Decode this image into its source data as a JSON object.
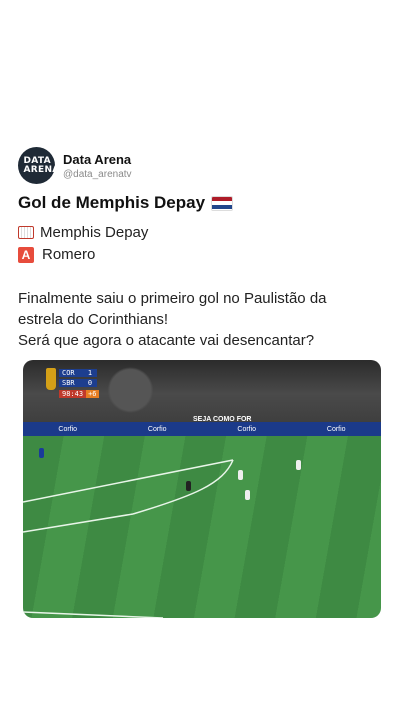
{
  "account": {
    "avatar_text": "DATA ARENA",
    "name": "Data Arena",
    "handle": "@data_arenatv"
  },
  "post": {
    "title": "Gol de Memphis Depay",
    "goal_line": "Memphis Depay",
    "assist_line": "Romero",
    "assist_badge": "A",
    "body_lines": [
      "Finalmente saiu o primeiro gol no Paulistão da",
      "estrela do Corinthians!",
      "Será que agora o atacante vai desencantar?"
    ]
  },
  "video": {
    "scorebug": {
      "team1": "COR",
      "score1": "1",
      "team2": "SBR",
      "score2": "0",
      "time": "98:43",
      "added": "+6"
    },
    "banner_texts": [
      "Corfio",
      "Corfio",
      "Corfio",
      "Corfio"
    ],
    "crowd_text": "SEJA COMO FOR"
  },
  "colors": {
    "flag_nl": [
      "#ae1c28",
      "#ffffff",
      "#21468b"
    ]
  }
}
